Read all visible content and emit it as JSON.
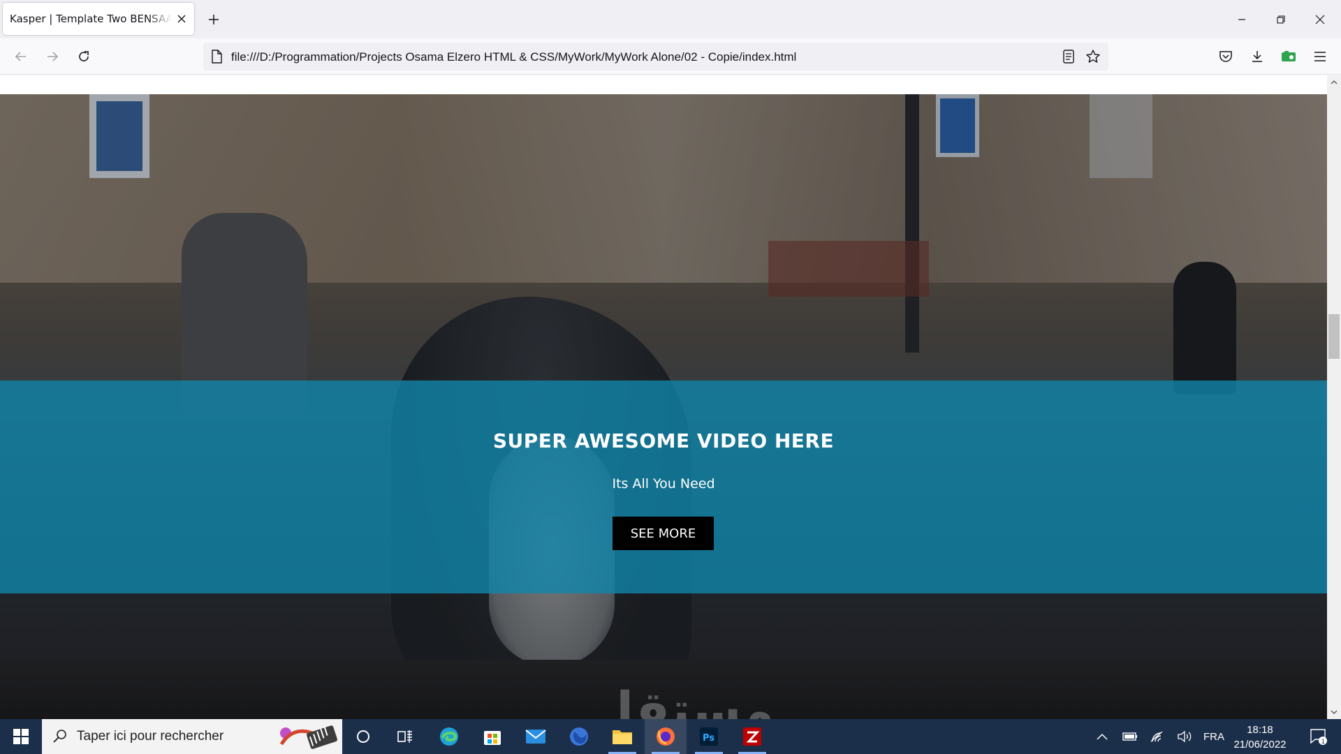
{
  "browser": {
    "tab": {
      "title": "Kasper | Template Two BENSAAD A"
    },
    "url": "file:///D:/Programmation/Projects Osama Elzero HTML & CSS/MyWork/MyWork Alone/02 - Copie/index.html"
  },
  "page": {
    "video": {
      "title": "SUPER AWESOME VIDEO HERE",
      "subtitle": "Its All You Need",
      "button": "SEE MORE"
    },
    "watermark": "مستقل"
  },
  "taskbar": {
    "search_placeholder": "Taper ici pour rechercher",
    "language": "FRA",
    "time": "18:18",
    "date": "21/06/2022",
    "notification_count": "1",
    "apps": [
      "cortana",
      "task-view",
      "edge",
      "microsoft-store",
      "mail",
      "firefox",
      "file-explorer",
      "firefox-dev",
      "photoshop",
      "filezilla"
    ]
  },
  "colors": {
    "band": "#1086aa",
    "button": "#000000",
    "taskbar": "#1c2f4a"
  }
}
